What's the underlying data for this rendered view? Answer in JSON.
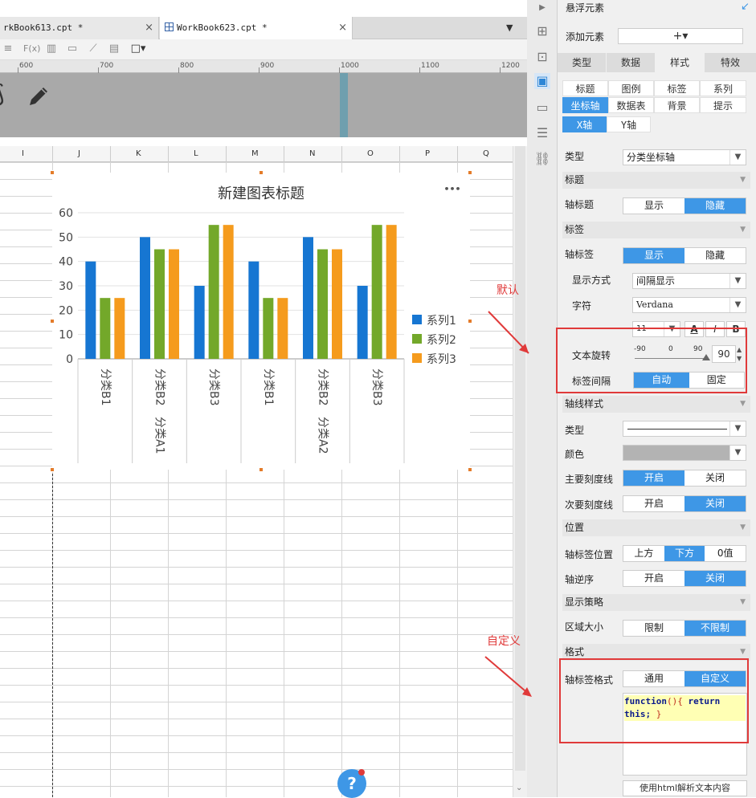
{
  "tabs": [
    {
      "label": "rkBook613.cpt *",
      "close": "×"
    },
    {
      "label": "WorkBook623.cpt *",
      "close": "×"
    }
  ],
  "ruler_marks": [
    "600",
    "700",
    "800",
    "900",
    "1000",
    "1100",
    "1200"
  ],
  "columns": [
    "I",
    "J",
    "K",
    "L",
    "M",
    "N",
    "O",
    "P",
    "Q"
  ],
  "chart_data": {
    "type": "bar",
    "title": "新建图表标题",
    "categories": [
      "分类B1",
      "分类B2",
      "分类B3",
      "分类B1",
      "分类B2",
      "分类B3"
    ],
    "groups": [
      "分类A1",
      "分类A2"
    ],
    "series": [
      {
        "name": "系列1",
        "color": "#1676d2",
        "values": [
          40,
          50,
          30,
          40,
          50,
          30
        ]
      },
      {
        "name": "系列2",
        "color": "#73a82a",
        "values": [
          25,
          45,
          55,
          25,
          45,
          55
        ]
      },
      {
        "name": "系列3",
        "color": "#f59b1d",
        "values": [
          25,
          45,
          55,
          25,
          45,
          55
        ]
      }
    ],
    "yticks": [
      "60",
      "50",
      "40",
      "30",
      "20",
      "10",
      "0"
    ],
    "ylim": [
      0,
      60
    ],
    "legend": "right",
    "menu": "•••"
  },
  "panel": {
    "title": "悬浮元素",
    "add_label": "添加元素",
    "add_button": "+▾",
    "main_tabs": [
      "类型",
      "数据",
      "样式",
      "特效"
    ],
    "sub_tabs": [
      "标题",
      "图例",
      "标签",
      "系列",
      "坐标轴",
      "数据表",
      "背景",
      "提示"
    ],
    "axis_tabs": [
      "X轴",
      "Y轴"
    ],
    "type_label": "类型",
    "type_value": "分类坐标轴",
    "sec_title": "标题",
    "axis_title_label": "轴标题",
    "axis_title_opts": [
      "显示",
      "隐藏"
    ],
    "sec_label": "标签",
    "axis_label_label": "轴标签",
    "axis_label_opts": [
      "显示",
      "隐藏"
    ],
    "display_mode_label": "显示方式",
    "display_mode_value": "间隔显示",
    "font_label": "字符",
    "font_value": "Verdana",
    "font_size": "11",
    "style_buttons": [
      "A",
      "I",
      "B"
    ],
    "rotate_label": "文本旋转",
    "rotate_scale": [
      "-90",
      "0",
      "90"
    ],
    "rotate_value": "90",
    "interval_label": "标签间隔",
    "interval_opts": [
      "自动",
      "固定"
    ],
    "sec_line_style": "轴线样式",
    "line_type_label": "类型",
    "color_label": "颜色",
    "major_tick_label": "主要刻度线",
    "major_tick_opts": [
      "开启",
      "关闭"
    ],
    "minor_tick_label": "次要刻度线",
    "minor_tick_opts": [
      "开启",
      "关闭"
    ],
    "sec_position": "位置",
    "label_pos_label": "轴标签位置",
    "label_pos_opts": [
      "上方",
      "下方",
      "0值"
    ],
    "reverse_label": "轴逆序",
    "reverse_opts": [
      "开启",
      "关闭"
    ],
    "sec_strategy": "显示策略",
    "area_label": "区域大小",
    "area_opts": [
      "限制",
      "不限制"
    ],
    "sec_format": "格式",
    "format_label": "轴标签格式",
    "format_opts": [
      "通用",
      "自定义"
    ],
    "code_line1a": "function",
    "code_line1b": "(){",
    "code_line1c": " return",
    "code_line2a": "this;",
    "code_line2b": " }",
    "html_button": "使用html解析文本内容"
  },
  "annotations": {
    "default": "默认",
    "custom": "自定义"
  },
  "help": "?"
}
